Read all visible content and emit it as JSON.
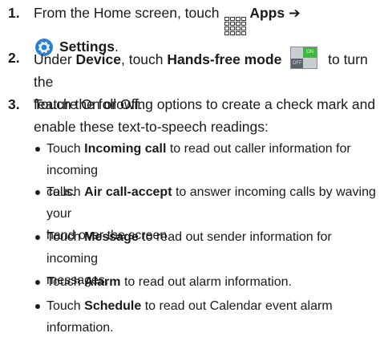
{
  "steps": [
    {
      "number": "1.",
      "text_a": "From the Home screen, touch",
      "apps": "Apps",
      "arrow": "➔",
      "settings": "Settings",
      "period": "."
    },
    {
      "number": "2.",
      "text_a": "Under",
      "device": "Device",
      "text_b": ", touch",
      "handsfree": "Hands-free mode",
      "text_c": "to turn the",
      "text_d": "feature On or Off.",
      "toggle_on": "ON",
      "toggle_off": "OFF"
    },
    {
      "number": "3.",
      "line1": "Touch the following options to create a check mark and",
      "line2": "enable these text-to-speech readings:"
    }
  ],
  "bullets": [
    {
      "pre": "Touch ",
      "bold": "Incoming call",
      "post1": " to read out caller information for incoming",
      "post2": "calls."
    },
    {
      "pre": "Touch ",
      "bold": "Air call-accept",
      "post1": " to answer incoming calls by waving your",
      "post2": "hand over the screen."
    },
    {
      "pre": "Touch ",
      "bold": "Message",
      "post1": " to read out sender information for incoming",
      "post2": "messages."
    },
    {
      "pre": "Touch ",
      "bold": "Alarm",
      "post1": " to read out alarm information."
    },
    {
      "pre": "Touch ",
      "bold": "Schedule",
      "post1": " to read out Calendar event alarm information."
    }
  ]
}
